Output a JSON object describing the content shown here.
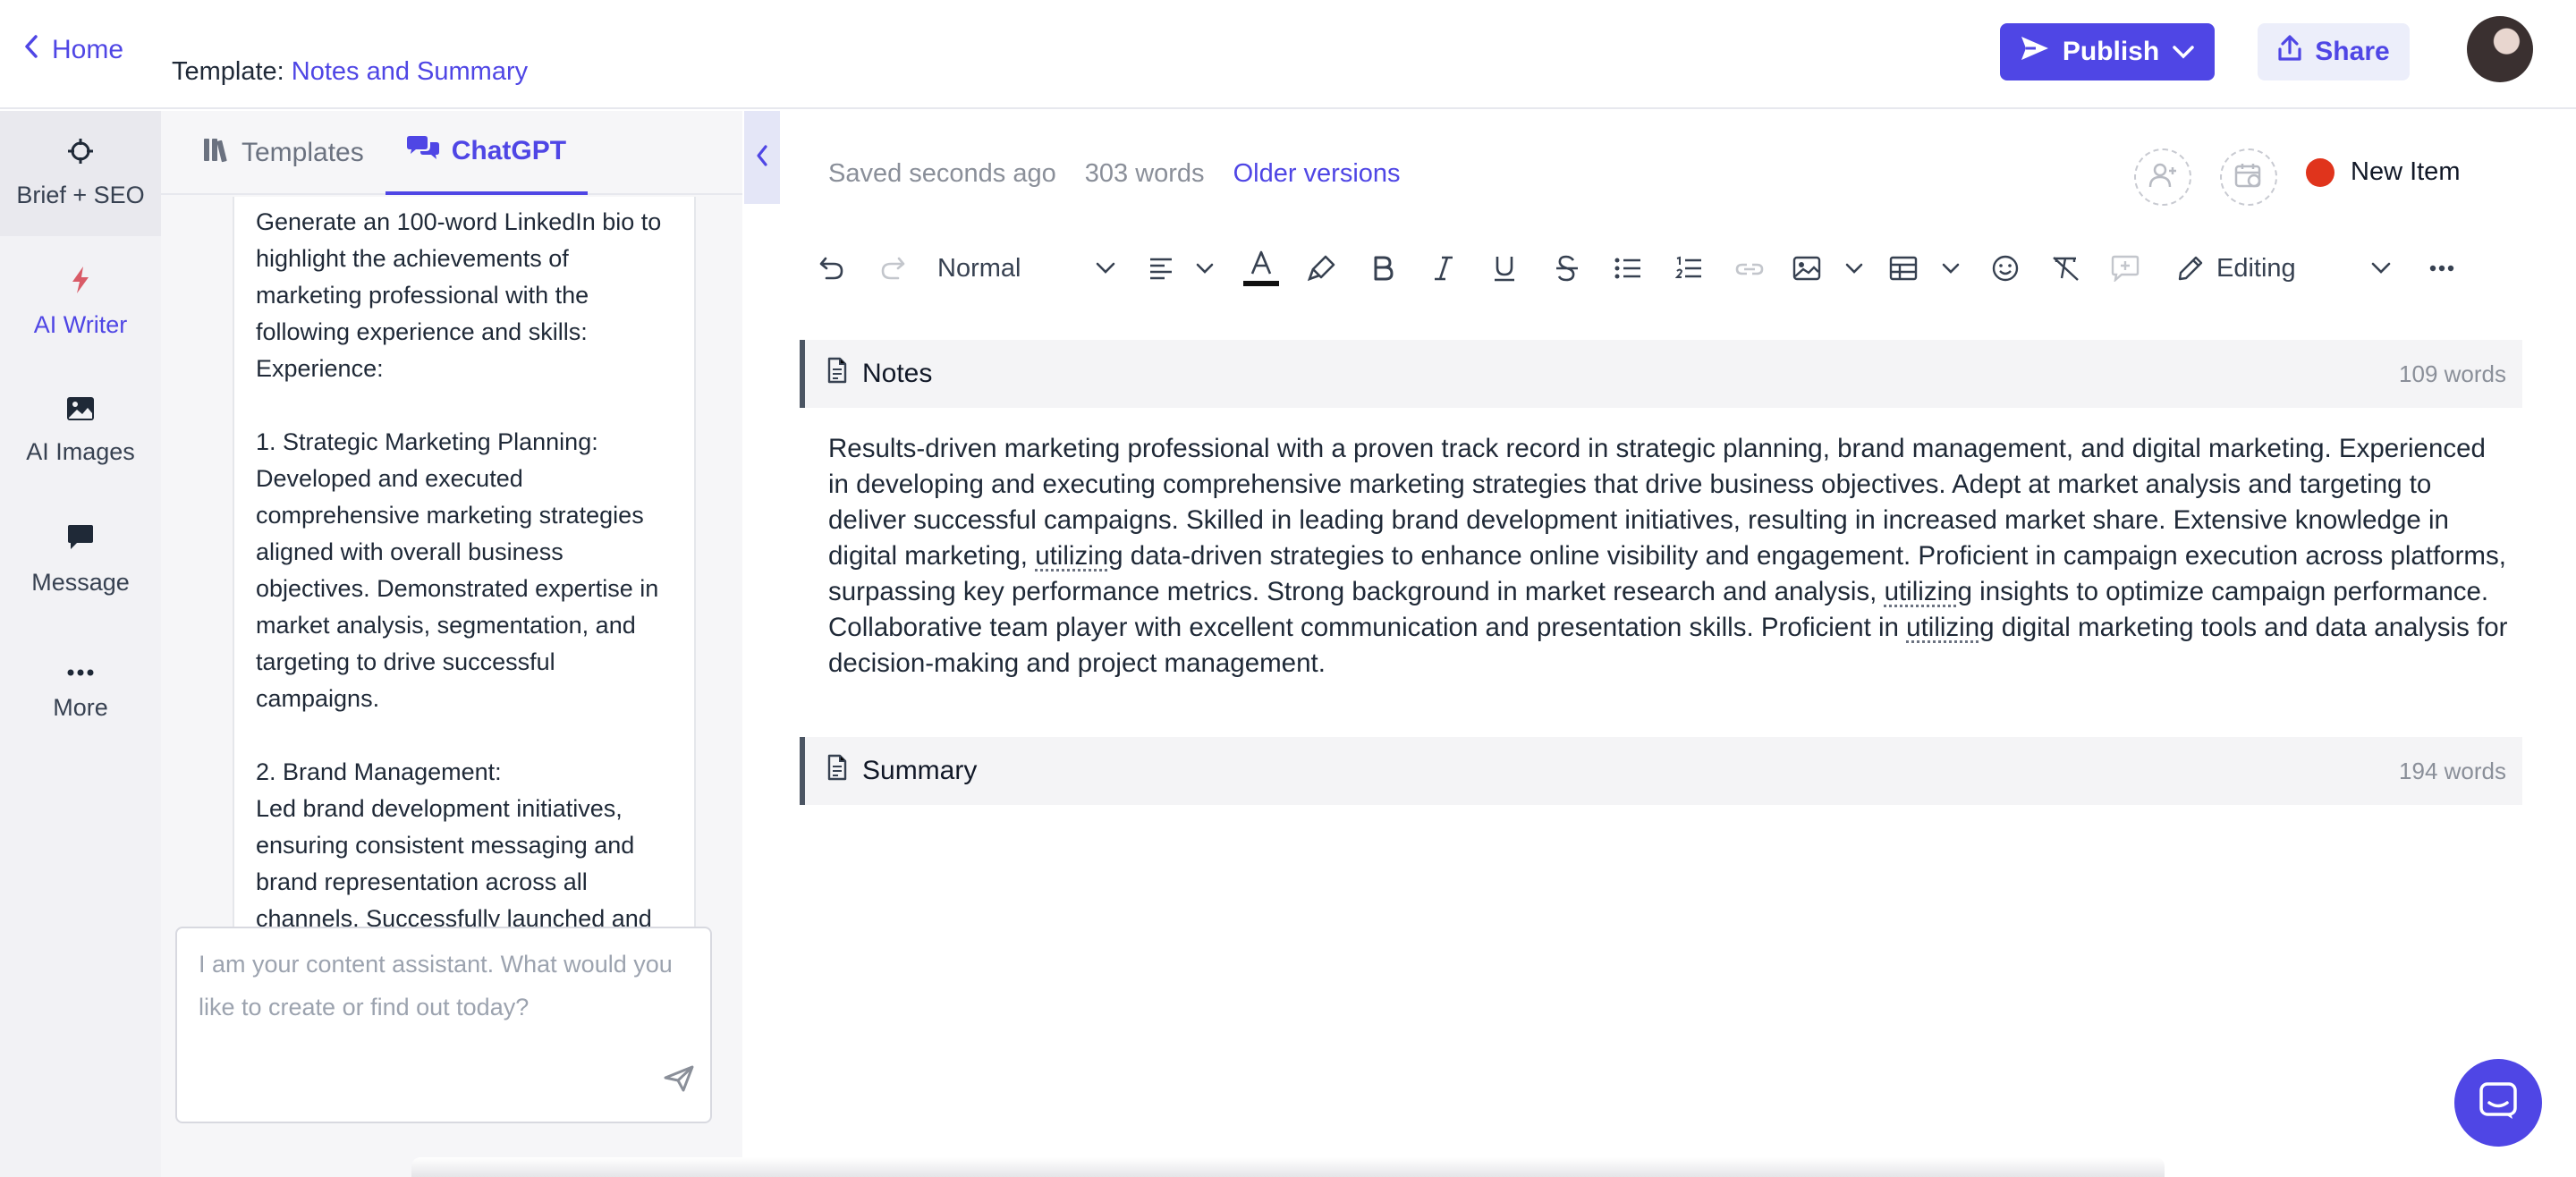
{
  "header": {
    "home_label": "Home",
    "template_prefix": "Template: ",
    "template_name": "Notes and Summary",
    "publish_label": "Publish",
    "share_label": "Share"
  },
  "rail": {
    "items": [
      {
        "label": "Brief + SEO",
        "icon": "crosshair-icon"
      },
      {
        "label": "AI Writer",
        "icon": "bolt-icon"
      },
      {
        "label": "AI Images",
        "icon": "image-icon"
      },
      {
        "label": "Message",
        "icon": "message-icon"
      },
      {
        "label": "More",
        "icon": "more-icon"
      }
    ]
  },
  "sidepanel": {
    "tabs": [
      {
        "label": "Templates",
        "icon": "books-icon"
      },
      {
        "label": "ChatGPT",
        "icon": "chat-icon"
      }
    ],
    "chat_message": "Generate an 100-word LinkedIn bio to highlight the achievements of marketing professional with the following experience and skills: Experience:\n\n1. Strategic Marketing Planning: Developed and executed comprehensive marketing strategies aligned with overall business objectives. Demonstrated expertise in market analysis, segmentation, and targeting to drive successful campaigns.\n\n2. Brand Management:\nLed brand development initiatives, ensuring consistent messaging and brand representation across all channels. Successfully launched and revitalized brands, resulting in",
    "input_placeholder": "I am your content assistant. What would you like to create or find out today?"
  },
  "editor": {
    "saved_status": "Saved seconds ago",
    "word_count": "303 words",
    "older_versions": "Older versions",
    "new_item_label": "New Item",
    "status_color": "#e0341c",
    "toolbar": {
      "style_select": "Normal",
      "mode_select": "Editing"
    },
    "sections": [
      {
        "title": "Notes",
        "count": "109 words",
        "text_parts": [
          "Results-driven marketing professional with a proven track record in strategic planning, brand management, and digital marketing. Experienced in developing and executing comprehensive marketing strategies that drive business objectives. Adept at market analysis and targeting to deliver successful campaigns. Skilled in leading brand development initiatives, resulting in increased market share. Extensive knowledge in digital marketing, ",
          "utilizing",
          " data-driven strategies to enhance online visibility and engagement. Proficient in campaign execution across platforms, surpassing key performance metrics. Strong background in market research and analysis, ",
          "utilizing",
          " insights to optimize campaign performance. Collaborative team player with excellent communication and presentation skills. Proficient in ",
          "utilizing",
          " digital marketing tools and data analysis for decision-making and project management."
        ]
      },
      {
        "title": "Summary",
        "count": "194 words"
      }
    ]
  },
  "colors": {
    "accent": "#4f46e5",
    "rail_bg": "#f2f2f5"
  }
}
